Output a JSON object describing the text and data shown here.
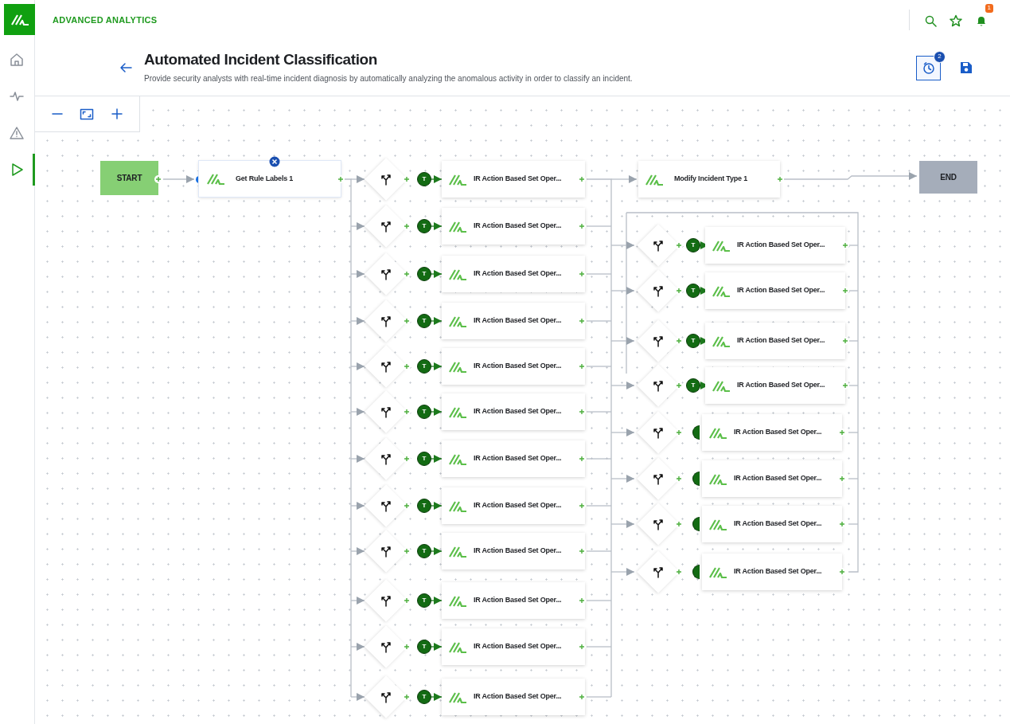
{
  "app": {
    "title": "ADVANCED ANALYTICS"
  },
  "sidebar": {
    "items": [
      {
        "kind": "home",
        "selected": false
      },
      {
        "kind": "activity",
        "selected": false
      },
      {
        "kind": "alert",
        "selected": false
      },
      {
        "kind": "play",
        "selected": true
      }
    ]
  },
  "header": {
    "actions": [
      {
        "kind": "search"
      },
      {
        "kind": "star"
      },
      {
        "kind": "bell",
        "badge": "1"
      }
    ]
  },
  "page": {
    "title": "Automated Incident Classification",
    "description": "Provide security analysts with real-time incident diagnosis by automatically analyzing the anomalous activity in order to classify an incident.",
    "actions": [
      {
        "kind": "timer",
        "badge": "2",
        "selected": true
      },
      {
        "kind": "save",
        "selected": false
      }
    ]
  },
  "zoom_controls": [
    {
      "kind": "zoom-out"
    },
    {
      "kind": "fit"
    },
    {
      "kind": "zoom-in"
    }
  ],
  "flow": {
    "start": {
      "label": "START"
    },
    "first_task": {
      "label": "Get Rule Labels 1",
      "selected": true
    },
    "left_branches": [
      {
        "trigger": "T",
        "task": "IR Action Based Set Oper..."
      },
      {
        "trigger": "T",
        "task": "IR Action Based Set Oper..."
      },
      {
        "trigger": "T",
        "task": "IR Action Based Set Oper..."
      },
      {
        "trigger": "T",
        "task": "IR Action Based Set Oper..."
      },
      {
        "trigger": "T",
        "task": "IR Action Based Set Oper..."
      },
      {
        "trigger": "T",
        "task": "IR Action Based Set Oper..."
      },
      {
        "trigger": "T",
        "task": "IR Action Based Set Oper..."
      },
      {
        "trigger": "T",
        "task": "IR Action Based Set Oper..."
      },
      {
        "trigger": "T",
        "task": "IR Action Based Set Oper..."
      },
      {
        "trigger": "T",
        "task": "IR Action Based Set Oper..."
      },
      {
        "trigger": "T",
        "task": "IR Action Based Set Oper..."
      },
      {
        "trigger": "T",
        "task": "IR Action Based Set Oper..."
      }
    ],
    "merge_task": {
      "label": "Modify Incident Type 1"
    },
    "end": {
      "label": "END"
    },
    "right_branches": [
      {
        "trigger": "T",
        "task": "IR Action Based Set Oper..."
      },
      {
        "trigger": "T",
        "task": "IR Action Based Set Oper..."
      },
      {
        "trigger": "T",
        "task": "IR Action Based Set Oper..."
      },
      {
        "trigger": "T",
        "task": "IR Action Based Set Oper..."
      },
      {
        "task": "IR Action Based Set Oper..."
      },
      {
        "task": "IR Action Based Set Oper..."
      },
      {
        "task": "IR Action Based Set Oper..."
      },
      {
        "task": "IR Action Based Set Oper..."
      }
    ]
  }
}
